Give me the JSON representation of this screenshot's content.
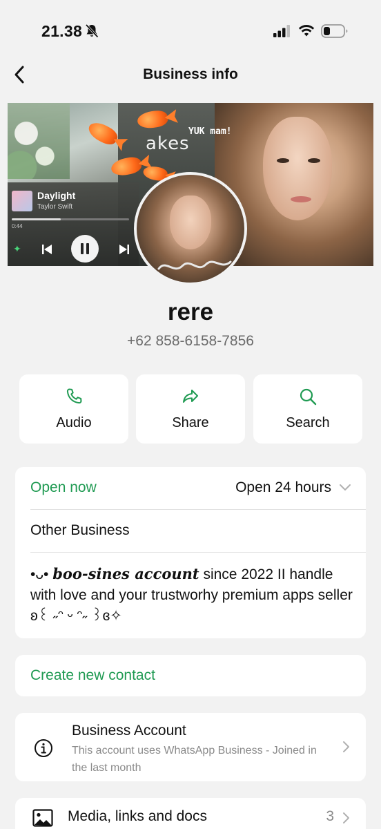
{
  "status_bar": {
    "time": "21.38",
    "icons": [
      "bell-slash-icon",
      "signal-icon",
      "wifi-icon",
      "battery-icon"
    ]
  },
  "header": {
    "title": "Business info",
    "back_icon": "chevron-left-icon"
  },
  "cover": {
    "overlay_text_1": "akes",
    "overlay_text_2": "YUK mam!",
    "player": {
      "track": "Daylight",
      "artist": "Taylor Swift",
      "elapsed": "0:44",
      "progress": 0.42
    }
  },
  "profile": {
    "name": "rere",
    "phone": "+62 858-6158-7856"
  },
  "actions": [
    {
      "label": "Audio",
      "icon": "phone-icon"
    },
    {
      "label": "Share",
      "icon": "share-arrow-icon"
    },
    {
      "label": "Search",
      "icon": "search-icon"
    }
  ],
  "business": {
    "open_status": "Open now",
    "hours": "Open 24 hours",
    "category": "Other Business",
    "about_prefix": "•ᴗ• ",
    "about_bold": "boo-sines account",
    "about_rest": " since 2022 II handle with love and your trustworhy premium apps seller ʚ꒰ ˶ᵔ ᵕ ᵔ˶ ꒱ɞ✧"
  },
  "create_contact": "Create new contact",
  "business_account": {
    "title": "Business Account",
    "description": "This account uses WhatsApp Business - Joined in the last month"
  },
  "media": {
    "title": "Media, links and docs",
    "count": "3"
  },
  "colors": {
    "accent_green": "#1f9a52",
    "background": "#f2f2f2",
    "card": "#ffffff",
    "secondary_text": "#8a8a8a"
  }
}
